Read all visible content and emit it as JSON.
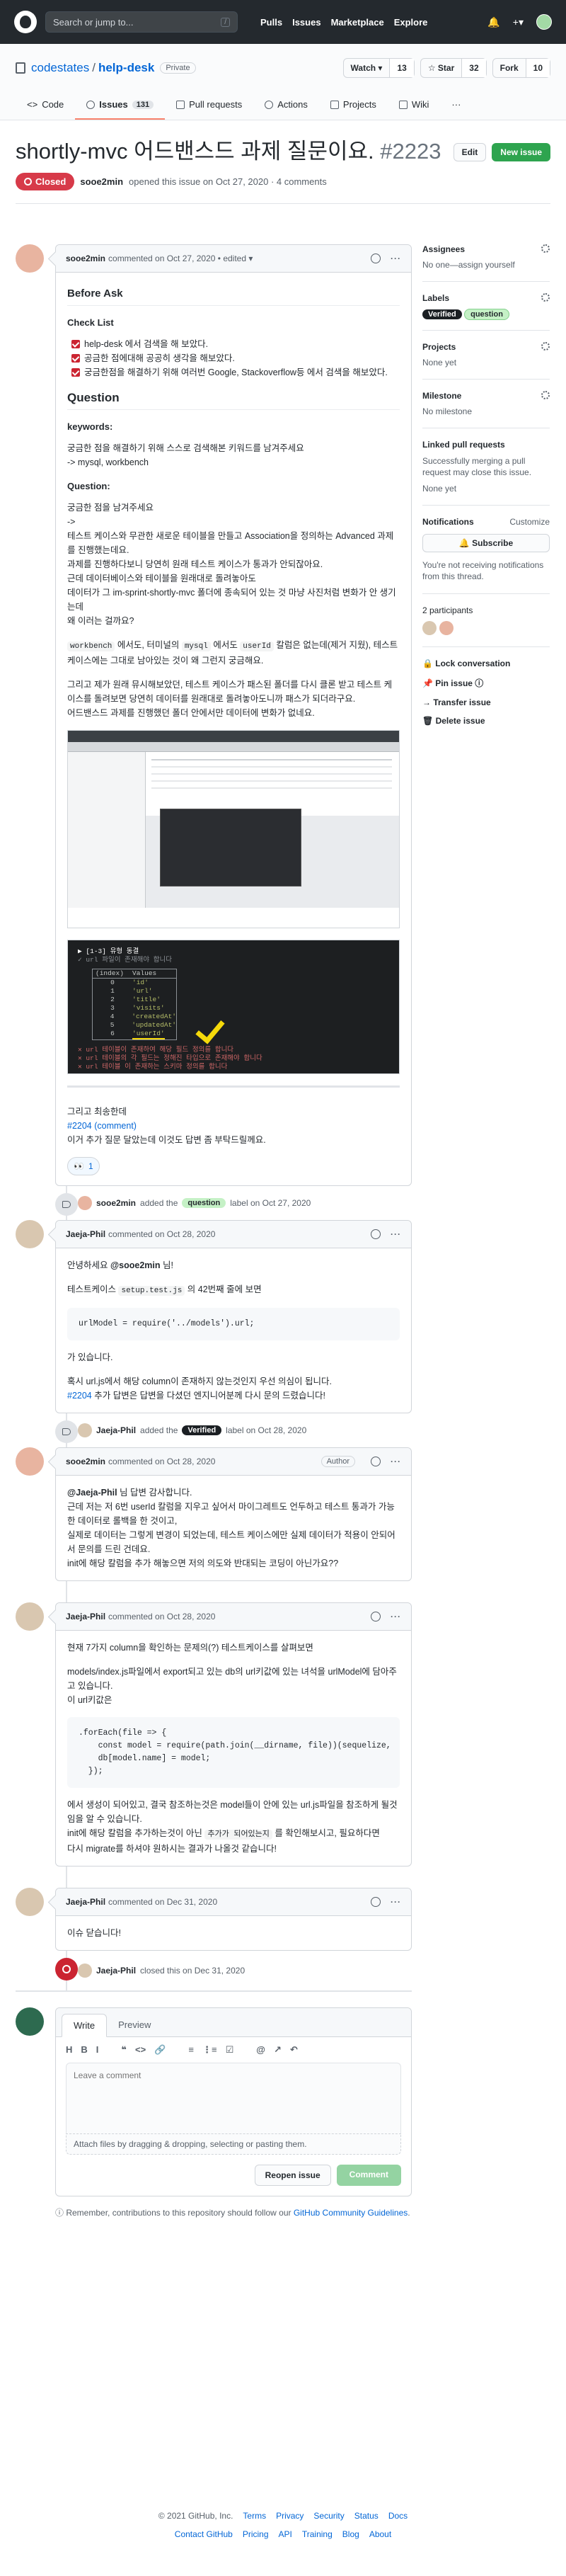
{
  "header": {
    "search_placeholder": "Search or jump to...",
    "search_key": "/",
    "nav": [
      "Pulls",
      "Issues",
      "Marketplace",
      "Explore"
    ],
    "plus": "+▾"
  },
  "repo": {
    "owner": "codestates",
    "sep": "/",
    "name": "help-desk",
    "visibility": "Private",
    "watch": {
      "label": "Watch ▾",
      "count": "13"
    },
    "star": {
      "label": "☆ Star",
      "count": "32"
    },
    "fork": {
      "label": "Fork",
      "count": "10"
    },
    "tabs": [
      {
        "label": "Code"
      },
      {
        "label": "Issues",
        "count": "131"
      },
      {
        "label": "Pull requests"
      },
      {
        "label": "Actions"
      },
      {
        "label": "Projects"
      },
      {
        "label": "Wiki"
      },
      {
        "label": "···"
      }
    ]
  },
  "issue": {
    "title": "shortly-mvc 어드밴스드 과제 질문이요.",
    "number": "#2223",
    "edit": "Edit",
    "new_issue": "New issue",
    "status": "Closed",
    "author": "sooe2min",
    "meta": "opened this issue on Oct 27, 2020 · 4 comments"
  },
  "c1": {
    "author": "sooe2min",
    "meta": "commented on Oct 27, 2020",
    "edited": "• edited ▾",
    "h_before": "Before Ask",
    "h_checklist": "Check List",
    "checks": [
      "help-desk 에서 검색을 해 보았다.",
      "공금한 점에대해 공공히 생각을 해보았다.",
      "궁금한점을 해결하기 위해 여러번 Google, Stackoverflow등 에서 검색을 해보았다."
    ],
    "h_question": "Question",
    "h_keywords": "keywords:",
    "kw1": "궁금한 점을 해결하기 위해 스스로 검색해본 키워드를 남겨주세요",
    "kw2": "-> mysql, workbench",
    "h_q": "Question:",
    "q1": "궁금한 점을 남겨주세요",
    "q2": "->",
    "q3": "테스트 케이스와 무관한 새로운 테이블을 만들고 Association을 정의하는 Advanced 과제를 진행했는데요.",
    "q4": "과제를 진행하다보니 당연히 원래 테스트 케이스가 통과가 안되잖아요.",
    "q5": "근데 데이터베이스와 테이블을 원래대로 돌려놓아도",
    "q6": "데이터가 그 im-sprint-shortly-mvc 폴더에 종속되어 있는 것 마냥 사진처럼 변화가 안 생기는데",
    "q7": "왜 이러는 걸까요?",
    "p2a": "workbench",
    "p2b": " 에서도, 터미널의 ",
    "p2c": "mysql",
    "p2d": " 에서도 ",
    "p2e": "userId",
    "p2f": " 칼럼은 없는데(제거 지웠), 테스트케이스에는 그대로 남아있는 것이 왜 그런지 궁금해요.",
    "p3a": "그리고 제가 원래 뮤시해보았던, 테스트 케이스가 패스된 폴더를 다시 클론 받고 테스트 케이스를 돌려보면 당연히 데이터를 원래대로 돌려놓아도니까 패스가 되더라구요.",
    "p3b": "어드밴스드 과제를 진행했던 폴더 안에서만 데이터에 변화가 없네요.",
    "f1": "그리고 최송한데",
    "f2": "#2204 (comment)",
    "f3": "이거 추가 질문 달았는데 이것도 답변 좀 부탁드릴께요.",
    "reaction": "1",
    "terminal": {
      "title": "▶ [1-3] 유형 동결",
      "sub": "✓ url 파일이 존재해야 합니다",
      "table_head": [
        "(index)",
        "Values"
      ],
      "rows": [
        [
          "0",
          "'id'"
        ],
        [
          "1",
          "'url'"
        ],
        [
          "2",
          "'title'"
        ],
        [
          "3",
          "'visits'"
        ],
        [
          "4",
          "'createdAt'"
        ],
        [
          "5",
          "'updatedAt'"
        ],
        [
          "6",
          "'userId'"
        ]
      ],
      "fail1": "✕ url 테이블이 존재하여 해당 필드 정의를 합니다",
      "fail2": "✕ url 테이블의 각 필드는 정해진 타입으로 존재해야 합니다",
      "fail3": "✕ url 테이블 이 존재하는 스키마 정의를 합니다"
    }
  },
  "e1": {
    "actor": "sooe2min",
    "action": "added the",
    "label": "question",
    "label_color": "#c5f1c6",
    "suffix": "label on Oct 27, 2020"
  },
  "c2": {
    "author": "Jaeja-Phil",
    "meta": "commented on Oct 28, 2020",
    "p1a": "안녕하세요 ",
    "p1b": "@sooe2min",
    "p1c": " 님!",
    "p2a": "테스트케이스 ",
    "p2b": "setup.test.js",
    "p2c": " 의 42번째 줄에 보면",
    "code": "urlModel = require('../models').url;",
    "p3": "가 있습니다.",
    "p4": "혹시 url.js에서 해당 column이 존재하지 않는것인지 우선 의심이 됩니다.",
    "p5a": "#2204",
    "p5b": " 추가 답변은 답변을 다셨던 엔지니어분께 다시 문의 드렸습니다!"
  },
  "e2": {
    "actor": "Jaeja-Phil",
    "action": "added the",
    "label": "Verified",
    "label_color": "#1b1f23",
    "suffix": "label on Oct 28, 2020"
  },
  "c3": {
    "author": "sooe2min",
    "meta": "commented on Oct 28, 2020",
    "badge": "Author",
    "l1a": "@Jaeja-Phil",
    "l1b": " 님 답변 감사합니다.",
    "l2": "근데 저는 저 6번 userId 칼럼을 지우고 싶어서 마이그레트도 언두하고 테스트 통과가 가능한 데이터로 롤백을 한 것이고,",
    "l3": "실제로 데이터는 그렇게 변경이 되었는데, 테스트 케이스에만 실제 데이터가 적용이 안되어서 문의를 드린 건데요.",
    "l4": "init에 해당 칼럼을 추가 해놓으면 저의 의도와 반대되는 코딩이 아닌가요??"
  },
  "c4": {
    "author": "Jaeja-Phil",
    "meta": "commented on Oct 28, 2020",
    "l1": "현재 7가지 column을 확인하는 문제의(?) 테스트케이스를 살펴보면",
    "l2": "models/index.js파일에서 export되고 있는 db의 url키값에 있는 녀석을 urlModel에 담아주고 있습니다.",
    "l3": "이 url키값은",
    "code": ".forEach(file => {\n    const model = require(path.join(__dirname, file))(sequelize,\n    db[model.name] = model;\n  });",
    "l4": "에서 생성이 되어있고, 결국 참조하는것은 model들이 안에 있는 url.js파일을 참조하게 될것임을 알 수 있습니다.",
    "l5a": "init에 해당 칼럼을 추가하는것이 아닌 ",
    "l5b": "추가가 되어있는지",
    "l5c": " 를 확인해보시고, 필요하다면",
    "l6": "다시 migrate를 하셔야 원하시는 결과가 나올것 같습니다!"
  },
  "c5": {
    "author": "Jaeja-Phil",
    "meta": "commented on Dec 31, 2020",
    "text": "이슈 닫습니다!"
  },
  "e3": {
    "actor": "Jaeja-Phil",
    "text": "closed this on Dec 31, 2020"
  },
  "editor": {
    "tab_write": "Write",
    "tab_preview": "Preview",
    "toolbar": [
      "H",
      "B",
      "I",
      "❝",
      "<>",
      "🔗",
      "≡",
      "⋮≡",
      "☑",
      "@",
      "↗",
      "↶"
    ],
    "placeholder": "Leave a comment",
    "attach": "Attach files by dragging & dropping, selecting or pasting them.",
    "reopen": "Reopen issue",
    "comment": "Comment"
  },
  "reminder": {
    "a": "Remember, contributions to this repository should follow our ",
    "b": "GitHub Community Guidelines",
    "c": "."
  },
  "sidebar": {
    "assignees_title": "Assignees",
    "assignees_val": "No one—assign yourself",
    "labels_title": "Labels",
    "labels": [
      {
        "name": "Verified",
        "bg": "#1b1f23",
        "fg": "#ffffff"
      },
      {
        "name": "question",
        "bg": "#c5f1c6",
        "fg": "#24292e"
      }
    ],
    "projects_title": "Projects",
    "projects_val": "None yet",
    "milestone_title": "Milestone",
    "milestone_val": "No milestone",
    "linked_title": "Linked pull requests",
    "linked_desc": "Successfully merging a pull request may close this issue.",
    "linked_val": "None yet",
    "notif_title": "Notifications",
    "notif_custom": "Customize",
    "subscribe": "🔔 Subscribe",
    "notif_desc": "You're not receiving notifications from this thread.",
    "participants": "2 participants",
    "actions": [
      "🔒 Lock conversation",
      "📌 Pin issue ⓘ",
      "→ Transfer issue",
      "🗑 Delete issue"
    ]
  },
  "footer": {
    "copy": "© 2021 GitHub, Inc.",
    "links1": [
      "Terms",
      "Privacy",
      "Security",
      "Status",
      "Docs"
    ],
    "links2": [
      "Contact GitHub",
      "Pricing",
      "API",
      "Training",
      "Blog",
      "About"
    ]
  },
  "colors": {
    "accent": "#0366d6",
    "closed": "#d73a49",
    "green": "#2ea44f"
  }
}
